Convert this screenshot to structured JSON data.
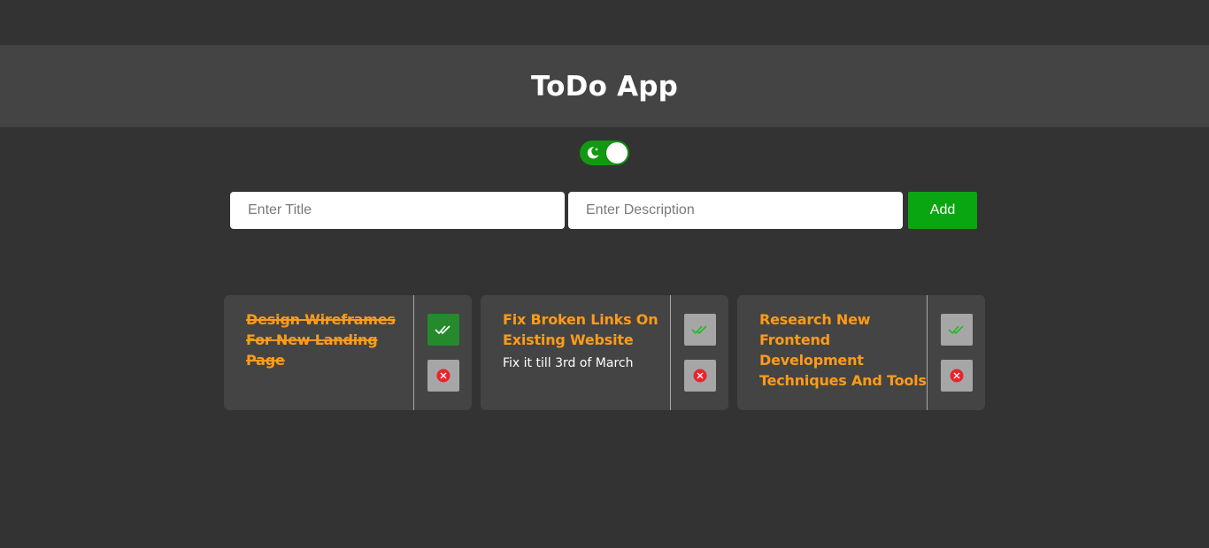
{
  "header": {
    "title": "ToDo App"
  },
  "theme_toggle": {
    "icon": "moon-icon",
    "on": true,
    "color": "#119911"
  },
  "form": {
    "title_placeholder": "Enter Title",
    "title_value": "",
    "description_placeholder": "Enter Description",
    "description_value": "",
    "add_label": "Add",
    "add_color": "#0aa612"
  },
  "todos": [
    {
      "title": "Design Wireframes For New Landing Page",
      "description": "",
      "completed": true
    },
    {
      "title": "Fix Broken Links On Existing Website",
      "description": "Fix it till 3rd of March",
      "completed": false
    },
    {
      "title": "Research New Frontend Development Techniques And Tools",
      "description": "",
      "completed": false
    }
  ],
  "colors": {
    "background": "#333333",
    "panel": "#444444",
    "todo_title": "#ff9b17",
    "complete_active": "#258a2c",
    "delete_icon": "#e8242c"
  }
}
